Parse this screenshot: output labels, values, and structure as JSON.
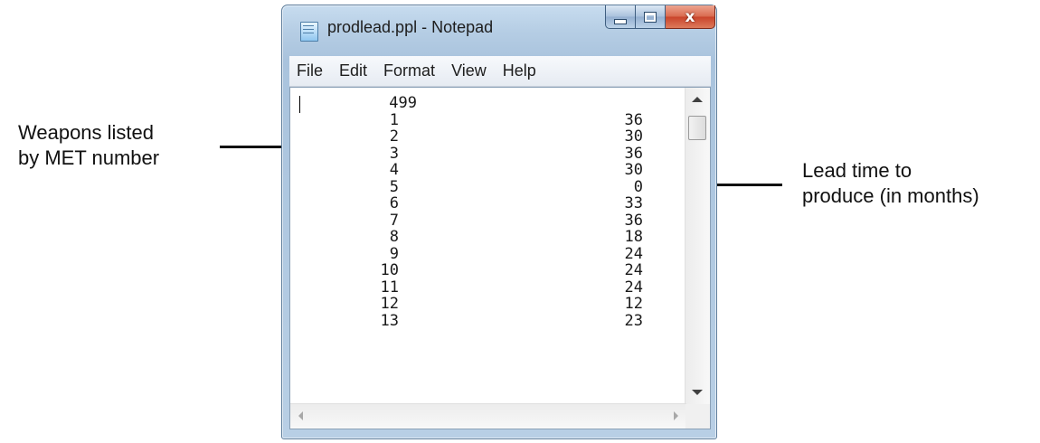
{
  "annotations": {
    "left": {
      "line1": "Weapons listed",
      "line2": "by MET number"
    },
    "right": {
      "line1": "Lead time to",
      "line2": "produce (in months)"
    }
  },
  "window": {
    "title": "prodlead.ppl - Notepad",
    "icon": "notepad-icon",
    "caption_buttons": [
      "minimize-icon",
      "maximize-icon",
      "close-icon"
    ],
    "close_glyph": "x",
    "colors": {
      "close_button": "#c9432a",
      "frame": "#b5cde4"
    }
  },
  "menu": {
    "items": [
      "File",
      "Edit",
      "Format",
      "View",
      "Help"
    ]
  },
  "document": {
    "header_value": "499",
    "rows": [
      {
        "met": "1",
        "lead": "36"
      },
      {
        "met": "2",
        "lead": "30"
      },
      {
        "met": "3",
        "lead": "36"
      },
      {
        "met": "4",
        "lead": "30"
      },
      {
        "met": "5",
        "lead": "0"
      },
      {
        "met": "6",
        "lead": "33"
      },
      {
        "met": "7",
        "lead": "36"
      },
      {
        "met": "8",
        "lead": "18"
      },
      {
        "met": "9",
        "lead": "24"
      },
      {
        "met": "10",
        "lead": "24"
      },
      {
        "met": "11",
        "lead": "24"
      },
      {
        "met": "12",
        "lead": "12"
      },
      {
        "met": "13",
        "lead": "23"
      }
    ]
  }
}
